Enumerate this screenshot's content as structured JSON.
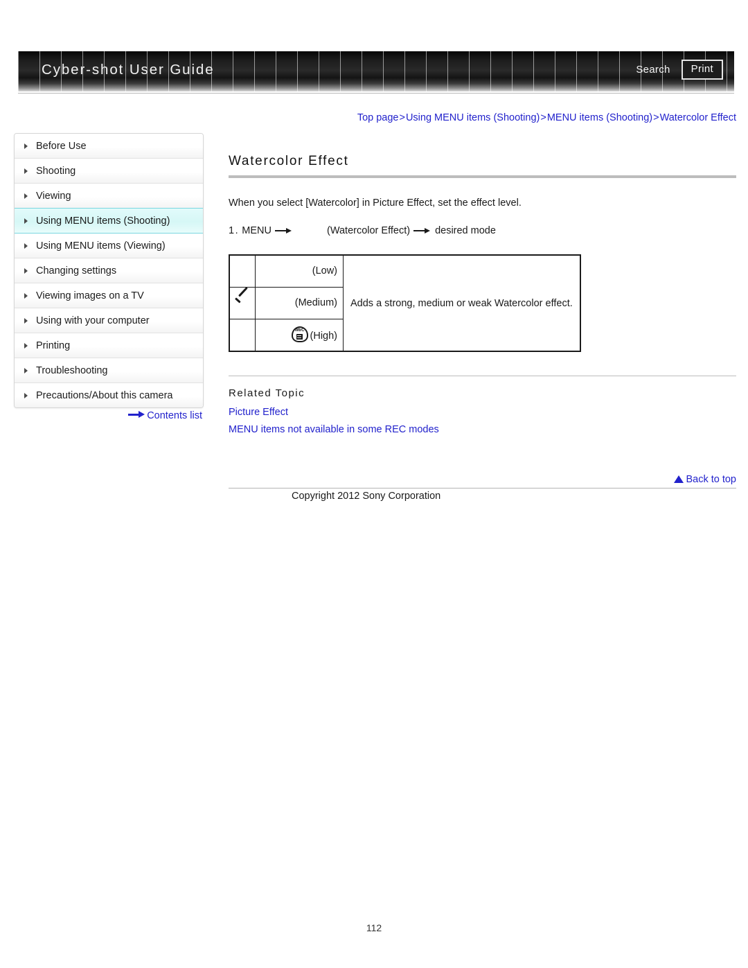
{
  "header": {
    "title": "Cyber-shot User Guide",
    "search_label": "Search",
    "print_label": "Print"
  },
  "breadcrumb": {
    "separator": ">",
    "items": [
      "Top page",
      "Using MENU items (Shooting)",
      "MENU items (Shooting)",
      "Watercolor Effect"
    ]
  },
  "sidebar": {
    "items": [
      {
        "label": "Before Use",
        "active": false
      },
      {
        "label": "Shooting",
        "active": false
      },
      {
        "label": "Viewing",
        "active": false
      },
      {
        "label": "Using MENU items (Shooting)",
        "active": true
      },
      {
        "label": "Using MENU items (Viewing)",
        "active": false
      },
      {
        "label": "Changing settings",
        "active": false
      },
      {
        "label": "Viewing images on a TV",
        "active": false
      },
      {
        "label": "Using with your computer",
        "active": false
      },
      {
        "label": "Printing",
        "active": false
      },
      {
        "label": "Troubleshooting",
        "active": false
      },
      {
        "label": "Precautions/About this camera",
        "active": false
      }
    ],
    "contents_list_label": "Contents list"
  },
  "main": {
    "title": "Watercolor Effect",
    "intro": "When you select [Watercolor] in Picture Effect, set the effect level.",
    "step": {
      "number": "1.",
      "menu_label": "MENU",
      "target_label": "(Watercolor Effect)",
      "result_label": "desired mode"
    },
    "table": {
      "rows": [
        {
          "checked": "",
          "level": "(Low)",
          "has_icon": false
        },
        {
          "checked": "check",
          "level": "(Medium)",
          "has_icon": false
        },
        {
          "checked": "",
          "level": "(High)",
          "has_icon": true
        }
      ],
      "description": "Adds a strong, medium or weak Watercolor effect.",
      "icon_tag": "WtrC"
    },
    "related": {
      "heading": "Related Topic",
      "links": [
        "Picture Effect",
        "MENU items not available in some REC modes"
      ]
    }
  },
  "footer": {
    "back_to_top_label": "Back to top",
    "copyright": "Copyright 2012 Sony Corporation",
    "page_number": "112"
  },
  "colors": {
    "link": "#2222cc",
    "active_nav": "#d6f7f6",
    "active_nav_border": "#79d6e0",
    "banner_dark": "#0b0b0b",
    "rule": "#bdbdbd"
  }
}
